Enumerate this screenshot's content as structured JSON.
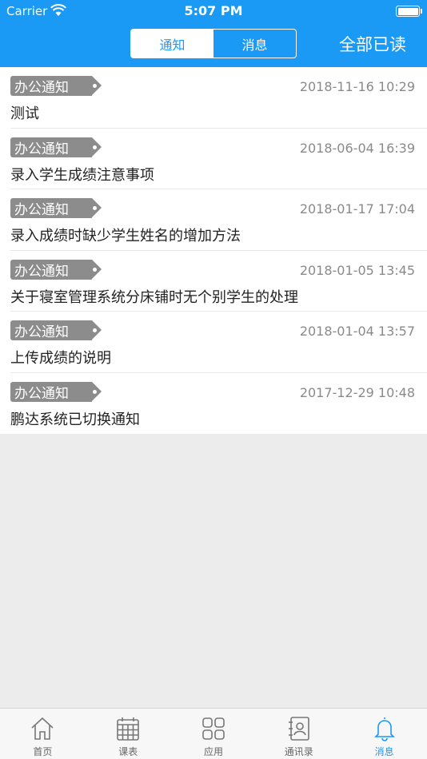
{
  "status_bar": {
    "carrier": "Carrier",
    "time": "5:07 PM"
  },
  "header": {
    "segments": [
      {
        "label": "通知",
        "active": true
      },
      {
        "label": "消息",
        "active": false
      }
    ],
    "mark_all_read": "全部已读"
  },
  "notifications": [
    {
      "tag": "办公通知",
      "time": "2018-11-16 10:29",
      "title": "测试"
    },
    {
      "tag": "办公通知",
      "time": "2018-06-04 16:39",
      "title": "录入学生成绩注意事项"
    },
    {
      "tag": "办公通知",
      "time": "2018-01-17 17:04",
      "title": "录入成绩时缺少学生姓名的增加方法"
    },
    {
      "tag": "办公通知",
      "time": "2018-01-05 13:45",
      "title": "关于寝室管理系统分床铺时无个别学生的处理"
    },
    {
      "tag": "办公通知",
      "time": "2018-01-04 13:57",
      "title": "上传成绩的说明"
    },
    {
      "tag": "办公通知",
      "time": "2017-12-29 10:48",
      "title": "鹏达系统已切换通知"
    }
  ],
  "tabbar": {
    "items": [
      {
        "label": "首页",
        "icon": "home-icon"
      },
      {
        "label": "课表",
        "icon": "calendar-icon"
      },
      {
        "label": "应用",
        "icon": "grid-icon"
      },
      {
        "label": "通讯录",
        "icon": "contacts-icon"
      },
      {
        "label": "消息",
        "icon": "bell-icon"
      }
    ],
    "active_index": 4
  },
  "colors": {
    "accent": "#1a99f5",
    "tag": "#8c8c8c",
    "background": "#ececec"
  }
}
